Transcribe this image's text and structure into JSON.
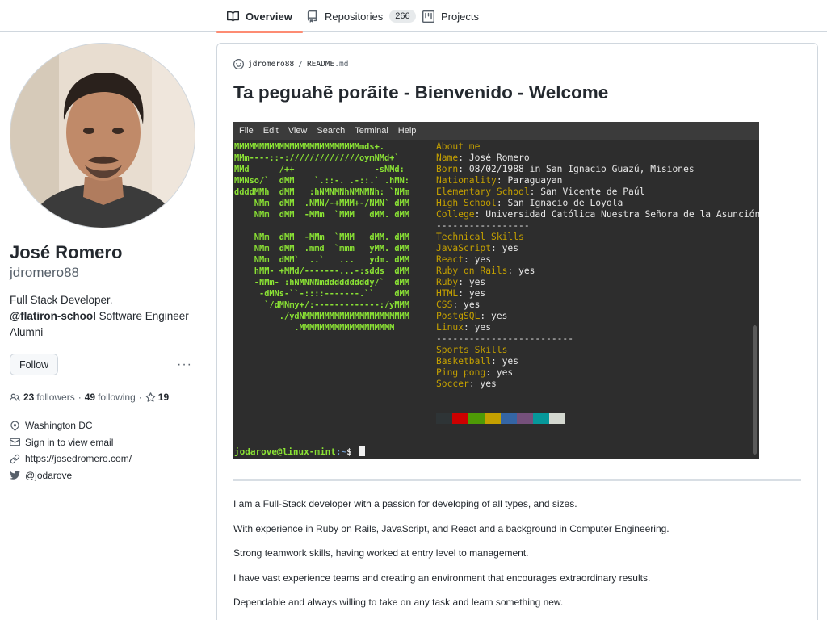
{
  "tabs": [
    {
      "label": "Overview",
      "icon": "book-icon",
      "active": true
    },
    {
      "label": "Repositories",
      "icon": "repo-icon",
      "count": "266"
    },
    {
      "label": "Projects",
      "icon": "project-icon"
    }
  ],
  "profile": {
    "fullname": "José Romero",
    "username": "jdromero88",
    "bio_line1": "Full Stack Developer.",
    "bio_org": "@flatiron-school",
    "bio_rest": " Software Engineer Alumni",
    "follow_label": "Follow",
    "more_label": "···",
    "followers_count": "23",
    "followers_label": "followers",
    "following_count": "49",
    "following_label": "following",
    "stars_count": "19",
    "location": "Washington DC",
    "email": "Sign in to view email",
    "website": "https://josedromero.com/",
    "twitter": "@jodarove"
  },
  "readme": {
    "owner": "jdromero88",
    "separator": "/",
    "file_base": "README",
    "file_ext": ".md",
    "title": "Ta peguahẽ porãite - Bienvenido - Welcome"
  },
  "terminal": {
    "menu": [
      "File",
      "Edit",
      "View",
      "Search",
      "Terminal",
      "Help"
    ],
    "ascii": "MMMMMMMMMMMMMMMMMMMMMMMMMmds+.\nMMm----::-://////////////oymNMd+`\nMMd      /++                -sNMd:\nMMNso/`  dMM    `.::-. .-::.` .hMN:\nddddMMh  dMM   :hNMNMNhNMNMNh: `NMm\n    NMm  dMM  .NMN/-+MMM+-/NMN` dMM\n    NMm  dMM  -MMm  `MMM   dMM. dMM\n\n    NMm  dMM  -MMm  `MMM   dMM. dMM\n    NMm  dMM  .mmd  `mmm   yMM. dMM\n    NMm  dMM`  ..`   ...   ydm. dMM\n    hMM- +MMd/-------...-:sdds  dMM\n    -NMm- :hNMNNNmdddddddddy/`  dMM\n     -dMNs-``-::::-------.``    dMM\n      `/dMNmy+/:-------------:/yMMM\n         ./ydNMMMMMMMMMMMMMMMMMMMMM\n            .MMMMMMMMMMMMMMMMMMM",
    "about_header": "About me",
    "fields": [
      {
        "k": "Name",
        "v": "José Romero"
      },
      {
        "k": "Born",
        "v": "08/02/1988 in San Ignacio Guazú, Misiones"
      },
      {
        "k": "Nationality",
        "v": "Paraguayan"
      },
      {
        "k": "Elementary School",
        "v": "San Vicente de Paúl"
      },
      {
        "k": "High School",
        "v": "San Ignacio de Loyola"
      },
      {
        "k": "College",
        "v": "Universidad Católica Nuestra Señora de la Asunción"
      }
    ],
    "dash1": "-----------------",
    "tech_header": "Technical Skills",
    "tech": [
      {
        "k": "JavaScript",
        "v": "yes"
      },
      {
        "k": "React",
        "v": "yes"
      },
      {
        "k": "Ruby on Rails",
        "v": "yes"
      },
      {
        "k": "Ruby",
        "v": "yes"
      },
      {
        "k": "HTML",
        "v": "yes"
      },
      {
        "k": "CSS",
        "v": "yes"
      },
      {
        "k": "PostgSQL",
        "v": "yes"
      },
      {
        "k": "Linux",
        "v": "yes"
      }
    ],
    "dash2": "-------------------------",
    "sports_header": "Sports Skills",
    "sports": [
      {
        "k": "Basketball",
        "v": "yes"
      },
      {
        "k": "Ping pong",
        "v": "yes"
      },
      {
        "k": "Soccer",
        "v": "yes"
      }
    ],
    "swatches": [
      "#2e3436",
      "#cc0000",
      "#4e9a06",
      "#c4a000",
      "#3465a4",
      "#75507b",
      "#06989a",
      "#d3d7cf"
    ],
    "prompt_user": "jodarove@linux-mint",
    "prompt_path": ":~",
    "prompt_sign": "$"
  },
  "paragraphs": [
    "I am a Full-Stack developer with a passion for developing of all types, and sizes.",
    "With experience in Ruby on Rails, JavaScript, and React and a background in Computer Engineering.",
    "Strong teamwork skills, having worked at entry level to management.",
    "I have vast experience teams and creating an environment that encourages extraordinary results.",
    "Dependable and always willing to take on any task and learn something new."
  ]
}
